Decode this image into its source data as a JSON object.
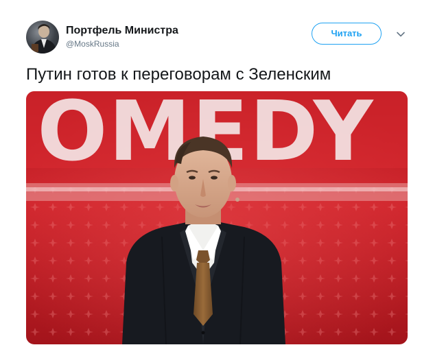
{
  "author": {
    "display_name": "Портфель Министра",
    "handle": "@MoskRussia"
  },
  "follow_button": {
    "label": "Читать"
  },
  "tweet": {
    "text": "Путин готов к переговорам с Зеленским"
  },
  "media": {
    "backdrop_text": "OMEDY"
  },
  "icons": {
    "menu_caret": "chevron-down-icon"
  },
  "colors": {
    "accent": "#1da1f2",
    "text_primary": "#14171a",
    "text_secondary": "#657786",
    "stage_red": "#c8232a"
  }
}
